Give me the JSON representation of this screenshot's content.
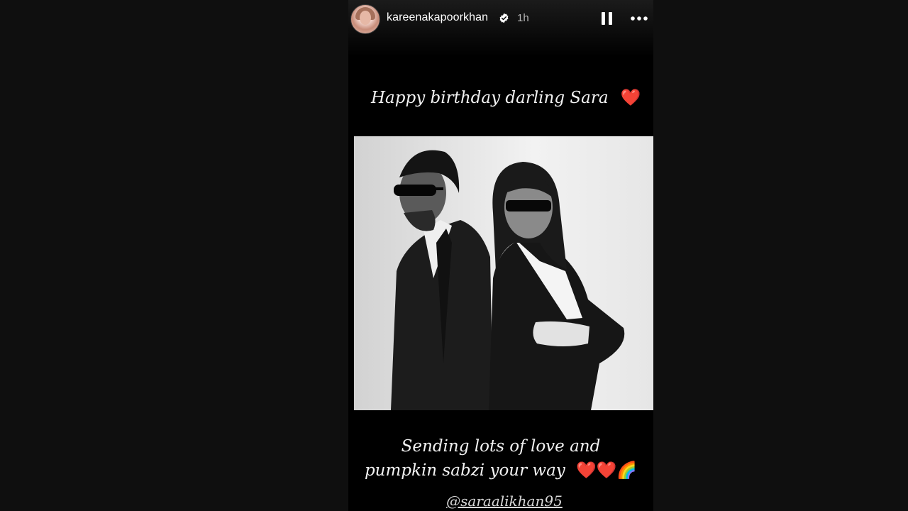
{
  "story": {
    "username": "kareenakapoorkhan",
    "verified": true,
    "time": "1h",
    "caption_top": "Happy birthday darling Sara",
    "caption_bottom_line1": "Sending lots of love and",
    "caption_bottom_line2": "pumpkin sabzi your way",
    "mention": "@saraalikhan95",
    "icons": {
      "verified": "verified-badge-icon",
      "pause": "pause-icon",
      "more": "more-options-icon",
      "heart": "red-heart-emoji",
      "rainbow": "rainbow-emoji"
    },
    "colors": {
      "background": "#0f0f0f",
      "story_bg": "#000000",
      "heart": "#e0262d"
    }
  }
}
